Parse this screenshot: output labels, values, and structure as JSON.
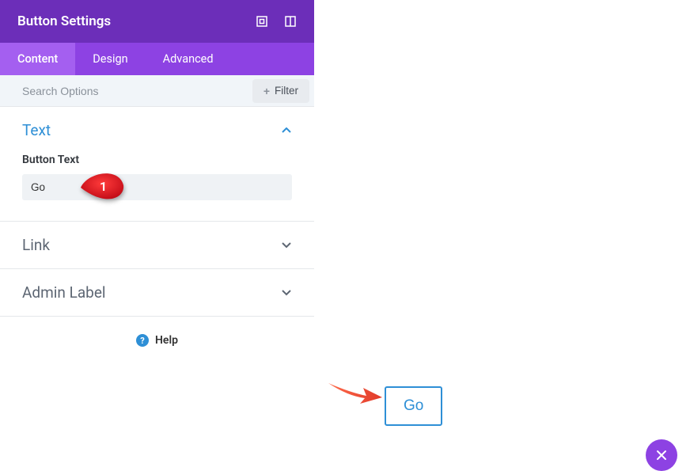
{
  "header": {
    "title": "Button Settings"
  },
  "tabs": {
    "content": "Content",
    "design": "Design",
    "advanced": "Advanced"
  },
  "search": {
    "placeholder": "Search Options",
    "filter_label": "Filter"
  },
  "sections": {
    "text": {
      "title": "Text",
      "button_text_label": "Button Text",
      "button_text_value": "Go"
    },
    "link": {
      "title": "Link"
    },
    "admin_label": {
      "title": "Admin Label"
    }
  },
  "help_label": "Help",
  "callout_number": "1",
  "preview_button": "Go"
}
